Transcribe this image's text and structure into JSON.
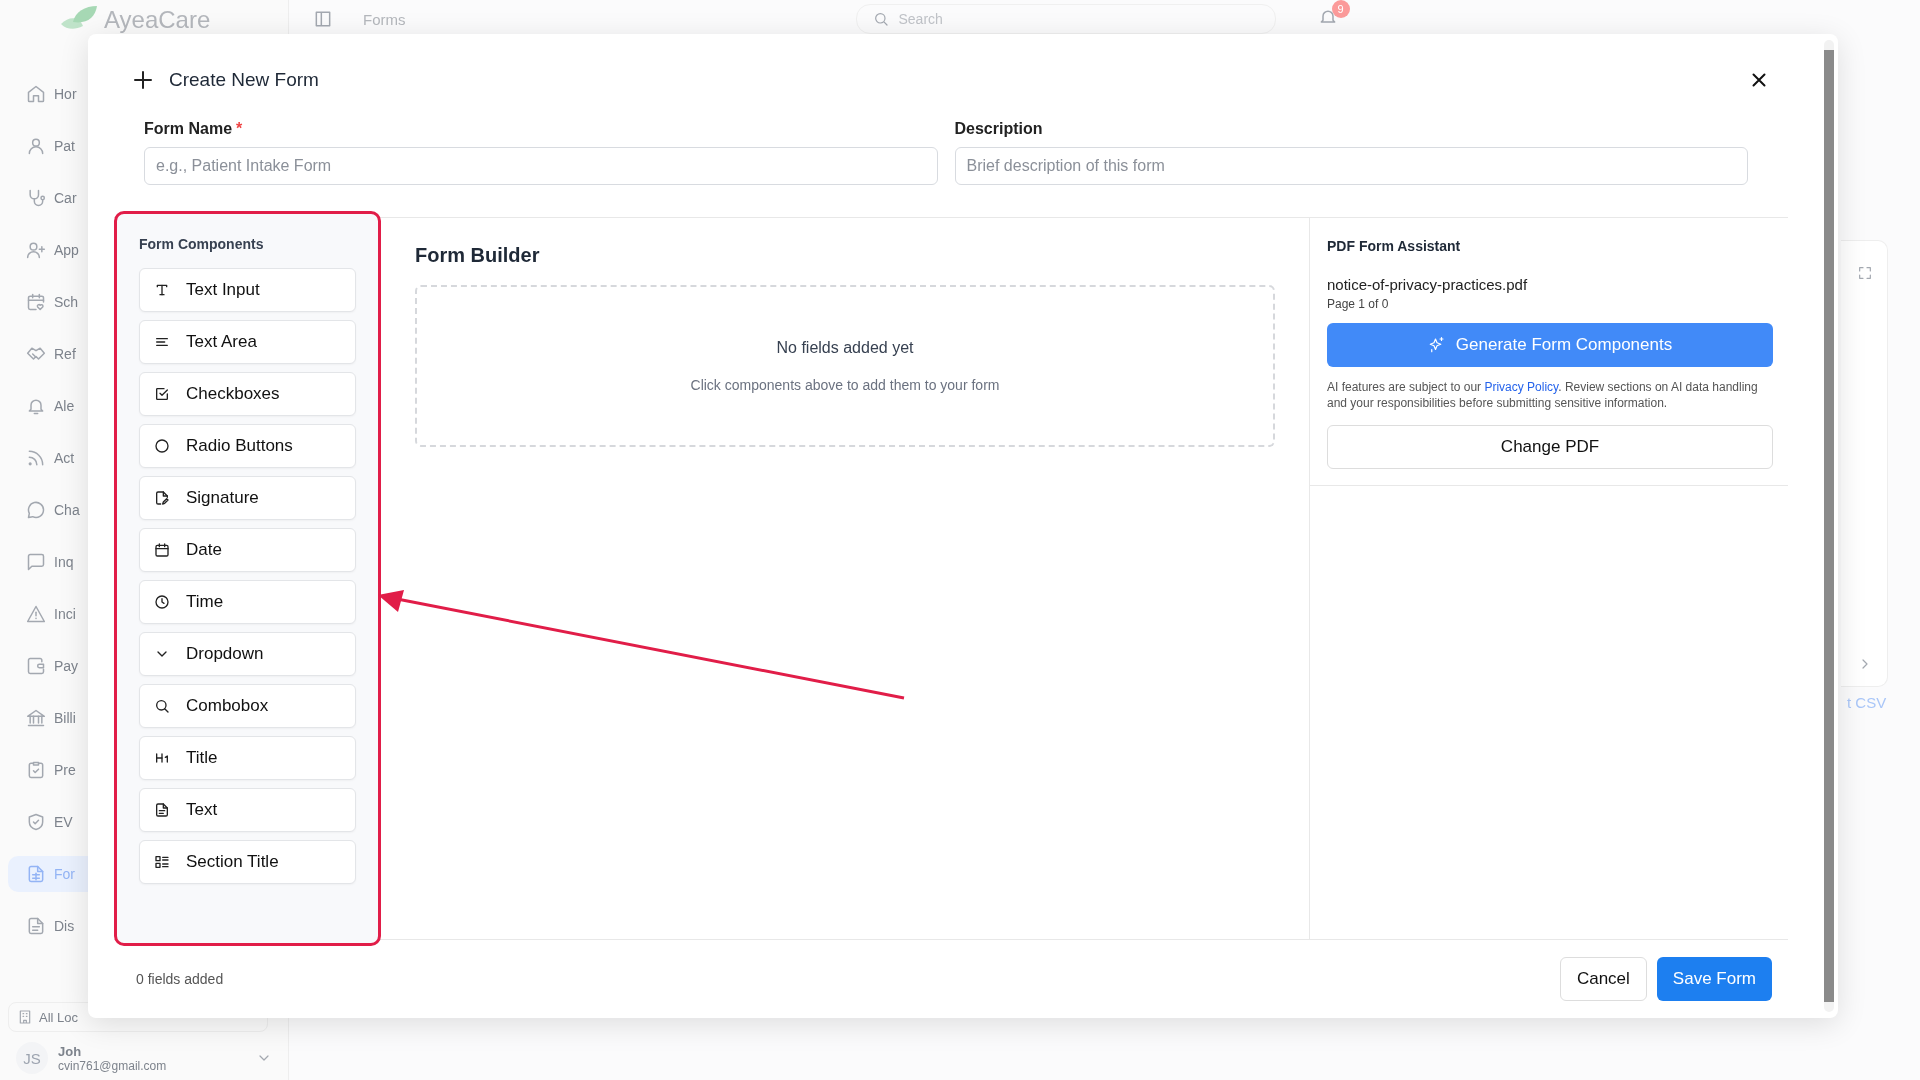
{
  "app_header": {
    "logo_text": "AyeaCare",
    "breadcrumb": "Forms",
    "search": {
      "placeholder": "Search"
    },
    "notification_count": "9"
  },
  "sidebar": {
    "items": [
      {
        "label": "Hor",
        "selected": false
      },
      {
        "label": "Pat",
        "selected": false
      },
      {
        "label": "Car",
        "selected": false
      },
      {
        "label": "App",
        "selected": false
      },
      {
        "label": "Sch",
        "selected": false
      },
      {
        "label": "Ref",
        "selected": false
      },
      {
        "label": "Ale",
        "selected": false
      },
      {
        "label": "Act",
        "selected": false
      },
      {
        "label": "Cha",
        "selected": false
      },
      {
        "label": "Inq",
        "selected": false
      },
      {
        "label": "Inci",
        "selected": false
      },
      {
        "label": "Pay",
        "selected": false
      },
      {
        "label": "Billi",
        "selected": false
      },
      {
        "label": "Pre",
        "selected": false
      },
      {
        "label": "EV",
        "selected": false
      },
      {
        "label": "For",
        "selected": true
      },
      {
        "label": "Dis",
        "selected": false
      }
    ],
    "location_selector": "All Loc",
    "user": {
      "initials": "JS",
      "name": "Joh",
      "email": "cvin761@gmail.com"
    }
  },
  "background_panel": {
    "link": "t CSV"
  },
  "dialog": {
    "title": "Create New Form",
    "fields": [
      {
        "label": "Form Name",
        "required_mark": "*",
        "placeholder": "e.g., Patient Intake Form"
      },
      {
        "label": "Description",
        "placeholder": "Brief description of this form"
      }
    ],
    "components_panel": {
      "title": "Form Components",
      "highlighted": true,
      "items": [
        {
          "label": "Text Input",
          "kind": "text_input"
        },
        {
          "label": "Text Area",
          "kind": "text_area"
        },
        {
          "label": "Checkboxes",
          "kind": "checkboxes"
        },
        {
          "label": "Radio Buttons",
          "kind": "radio"
        },
        {
          "label": "Signature",
          "kind": "signature"
        },
        {
          "label": "Date",
          "kind": "date"
        },
        {
          "label": "Time",
          "kind": "time"
        },
        {
          "label": "Dropdown",
          "kind": "dropdown"
        },
        {
          "label": "Combobox",
          "kind": "combobox"
        },
        {
          "label": "Title",
          "kind": "title"
        },
        {
          "label": "Text",
          "kind": "text"
        },
        {
          "label": "Section Title",
          "kind": "section"
        }
      ]
    },
    "builder": {
      "title": "Form Builder",
      "empty_title": "No fields added yet",
      "empty_hint": "Click components above to add them to your form"
    },
    "pdf_assistant": {
      "title": "PDF Form Assistant",
      "file_name": "notice-of-privacy-practices.pdf",
      "page_info": "Page 1 of 0",
      "generate_button": "Generate Form Components",
      "notice_before": "AI features are subject to our",
      "notice_link": "Privacy Policy",
      "notice_after": ". Review sections on AI data handling and your responsibilities before submitting sensitive information.",
      "change_button": "Change PDF"
    },
    "footer": {
      "status": "0 fields added",
      "buttons": [
        {
          "label": "Cancel",
          "kind": "secondary"
        },
        {
          "label": "Save Form",
          "kind": "primary"
        }
      ]
    }
  }
}
